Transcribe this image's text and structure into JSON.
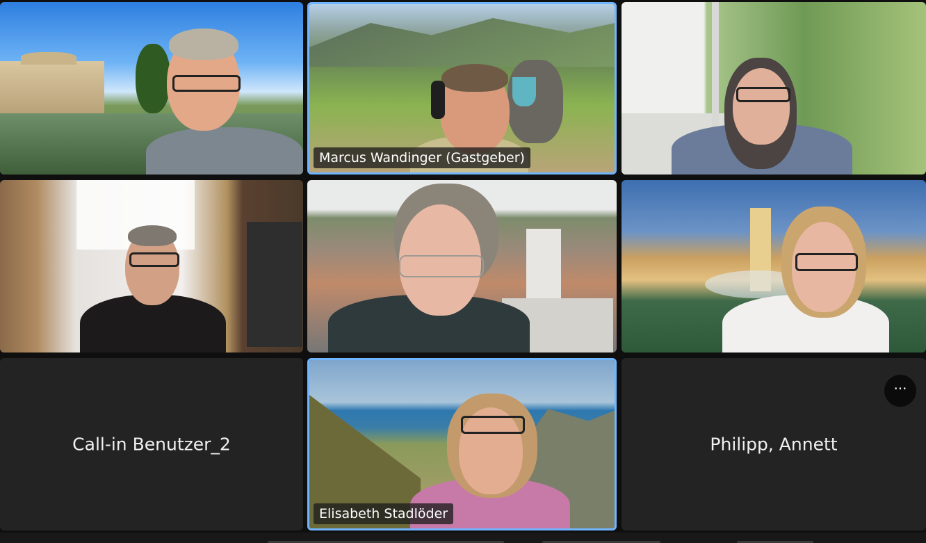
{
  "meeting": {
    "participants": [
      {
        "name": "",
        "tile": "top-left"
      },
      {
        "name": "Marcus Wandinger (Gastgeber)",
        "tile": "top-center",
        "active_speaker": true
      },
      {
        "name": "",
        "tile": "top-right"
      },
      {
        "name": "",
        "tile": "middle-left"
      },
      {
        "name": "",
        "tile": "middle-center"
      },
      {
        "name": "",
        "tile": "middle-right"
      },
      {
        "name": "Call-in Benutzer_2",
        "tile": "bottom-left",
        "video": false
      },
      {
        "name": "Elisabeth Stadlöder",
        "tile": "bottom-center",
        "active_speaker": true
      },
      {
        "name": "Philipp, Annett",
        "tile": "bottom-right",
        "video": false
      }
    ],
    "more_options_label": "···",
    "colors": {
      "active_border": "#6fb5ff",
      "tile_bg": "#232323",
      "page_bg": "#0f0f0f"
    }
  }
}
